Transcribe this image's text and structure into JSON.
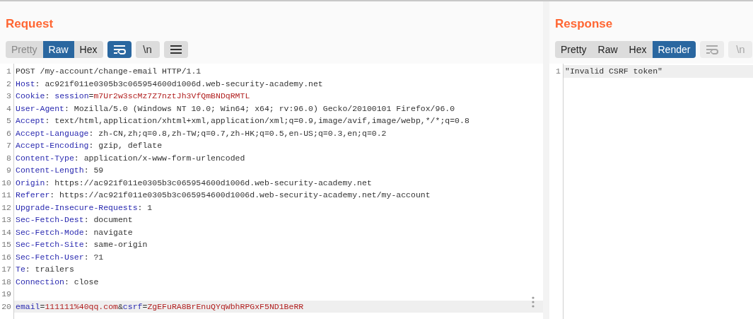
{
  "request": {
    "title": "Request",
    "tabs": [
      {
        "label": "Pretty",
        "selected": false,
        "disabled": true
      },
      {
        "label": "Raw",
        "selected": true,
        "disabled": false
      },
      {
        "label": "Hex",
        "selected": false,
        "disabled": false
      }
    ],
    "tools": [
      {
        "kind": "wrap",
        "selected": true,
        "disabled": false
      },
      {
        "kind": "newline",
        "label": "\\n",
        "selected": false,
        "disabled": false
      },
      {
        "kind": "menu",
        "selected": false,
        "disabled": false
      }
    ],
    "lines": [
      {
        "number": "1",
        "highlighted": false,
        "segments": [
          {
            "kind": "plain",
            "text": "POST /my-account/change-email HTTP/1.1"
          }
        ]
      },
      {
        "number": "2",
        "highlighted": false,
        "segments": [
          {
            "kind": "name",
            "text": "Host"
          },
          {
            "kind": "plain",
            "text": ": ac921f011e0305b3c065954600d1006d.web-security-academy.net"
          }
        ]
      },
      {
        "number": "3",
        "highlighted": false,
        "segments": [
          {
            "kind": "name",
            "text": "Cookie"
          },
          {
            "kind": "plain",
            "text": ": "
          },
          {
            "kind": "name",
            "text": "session"
          },
          {
            "kind": "plain",
            "text": "="
          },
          {
            "kind": "value",
            "text": "m7Ur2w3scMz7Z7nztJh3VfQmBNDqRMTL"
          }
        ]
      },
      {
        "number": "4",
        "highlighted": false,
        "segments": [
          {
            "kind": "name",
            "text": "User-Agent"
          },
          {
            "kind": "plain",
            "text": ": Mozilla/5.0 (Windows NT 10.0; Win64; x64; rv:96.0) Gecko/20100101 Firefox/96.0"
          }
        ]
      },
      {
        "number": "5",
        "highlighted": false,
        "segments": [
          {
            "kind": "name",
            "text": "Accept"
          },
          {
            "kind": "plain",
            "text": ": text/html,application/xhtml+xml,application/xml;q=0.9,image/avif,image/webp,*/*;q=0.8"
          }
        ]
      },
      {
        "number": "6",
        "highlighted": false,
        "segments": [
          {
            "kind": "name",
            "text": "Accept-Language"
          },
          {
            "kind": "plain",
            "text": ": zh-CN,zh;q=0.8,zh-TW;q=0.7,zh-HK;q=0.5,en-US;q=0.3,en;q=0.2"
          }
        ]
      },
      {
        "number": "7",
        "highlighted": false,
        "segments": [
          {
            "kind": "name",
            "text": "Accept-Encoding"
          },
          {
            "kind": "plain",
            "text": ": gzip, deflate"
          }
        ]
      },
      {
        "number": "8",
        "highlighted": false,
        "segments": [
          {
            "kind": "name",
            "text": "Content-Type"
          },
          {
            "kind": "plain",
            "text": ": application/x-www-form-urlencoded"
          }
        ]
      },
      {
        "number": "9",
        "highlighted": false,
        "segments": [
          {
            "kind": "name",
            "text": "Content-Length"
          },
          {
            "kind": "plain",
            "text": ": 59"
          }
        ]
      },
      {
        "number": "10",
        "highlighted": false,
        "segments": [
          {
            "kind": "name",
            "text": "Origin"
          },
          {
            "kind": "plain",
            "text": ": https://ac921f011e0305b3c065954600d1006d.web-security-academy.net"
          }
        ]
      },
      {
        "number": "11",
        "highlighted": false,
        "segments": [
          {
            "kind": "name",
            "text": "Referer"
          },
          {
            "kind": "plain",
            "text": ": https://ac921f011e0305b3c065954600d1006d.web-security-academy.net/my-account"
          }
        ]
      },
      {
        "number": "12",
        "highlighted": false,
        "segments": [
          {
            "kind": "name",
            "text": "Upgrade-Insecure-Requests"
          },
          {
            "kind": "plain",
            "text": ": 1"
          }
        ]
      },
      {
        "number": "13",
        "highlighted": false,
        "segments": [
          {
            "kind": "name",
            "text": "Sec-Fetch-Dest"
          },
          {
            "kind": "plain",
            "text": ": document"
          }
        ]
      },
      {
        "number": "14",
        "highlighted": false,
        "segments": [
          {
            "kind": "name",
            "text": "Sec-Fetch-Mode"
          },
          {
            "kind": "plain",
            "text": ": navigate"
          }
        ]
      },
      {
        "number": "15",
        "highlighted": false,
        "segments": [
          {
            "kind": "name",
            "text": "Sec-Fetch-Site"
          },
          {
            "kind": "plain",
            "text": ": same-origin"
          }
        ]
      },
      {
        "number": "16",
        "highlighted": false,
        "segments": [
          {
            "kind": "name",
            "text": "Sec-Fetch-User"
          },
          {
            "kind": "plain",
            "text": ": ?1"
          }
        ]
      },
      {
        "number": "17",
        "highlighted": false,
        "segments": [
          {
            "kind": "name",
            "text": "Te"
          },
          {
            "kind": "plain",
            "text": ": trailers"
          }
        ]
      },
      {
        "number": "18",
        "highlighted": false,
        "segments": [
          {
            "kind": "name",
            "text": "Connection"
          },
          {
            "kind": "plain",
            "text": ": close"
          }
        ]
      },
      {
        "number": "19",
        "highlighted": false
      },
      {
        "number": "20",
        "highlighted": true,
        "segments": [
          {
            "kind": "name",
            "text": "email"
          },
          {
            "kind": "plain",
            "text": "="
          },
          {
            "kind": "value",
            "text": "111111%40qq.com"
          },
          {
            "kind": "plain",
            "text": "&"
          },
          {
            "kind": "name",
            "text": "csrf"
          },
          {
            "kind": "plain",
            "text": "="
          },
          {
            "kind": "value",
            "text": "ZgEFuRA8BrEnuQYqWbhRPGxF5ND1BeRR"
          }
        ]
      }
    ]
  },
  "response": {
    "title": "Response",
    "tabs": [
      {
        "label": "Pretty",
        "selected": false,
        "disabled": false
      },
      {
        "label": "Raw",
        "selected": false,
        "disabled": false
      },
      {
        "label": "Hex",
        "selected": false,
        "disabled": false
      },
      {
        "label": "Render",
        "selected": true,
        "disabled": false
      }
    ],
    "tools": [
      {
        "kind": "wrap",
        "selected": false,
        "disabled": true
      },
      {
        "kind": "newline",
        "label": "\\n",
        "selected": false,
        "disabled": true
      }
    ],
    "lines": [
      {
        "number": "1",
        "highlighted": true,
        "segments": [
          {
            "kind": "plain",
            "text": "\"Invalid CSRF token\""
          }
        ]
      }
    ]
  }
}
